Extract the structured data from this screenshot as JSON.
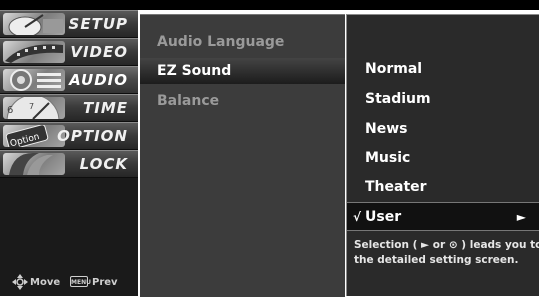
{
  "menu": {
    "items": [
      {
        "label": "SETUP",
        "icon": "satellite-dish-icon"
      },
      {
        "label": "VIDEO",
        "icon": "film-reel-icon"
      },
      {
        "label": "AUDIO",
        "icon": "speaker-icon"
      },
      {
        "label": "TIME",
        "icon": "clock-icon"
      },
      {
        "label": "OPTION",
        "icon": "option-tag-icon"
      },
      {
        "label": "LOCK",
        "icon": "padlock-icon"
      }
    ],
    "selected": "AUDIO",
    "footer": {
      "move": "Move",
      "menu_key": "MENU",
      "prev": "Prev"
    }
  },
  "submenu": {
    "items": [
      "Audio Language",
      "EZ Sound",
      "Balance"
    ],
    "selected": "EZ Sound"
  },
  "options": {
    "items": [
      "Normal",
      "Stadium",
      "News",
      "Music",
      "Theater"
    ],
    "selected": {
      "check": "√",
      "label": "User",
      "arrow": "►"
    },
    "help_text": "Selection ( ► or ⊙ ) leads you to the detailed setting screen."
  }
}
